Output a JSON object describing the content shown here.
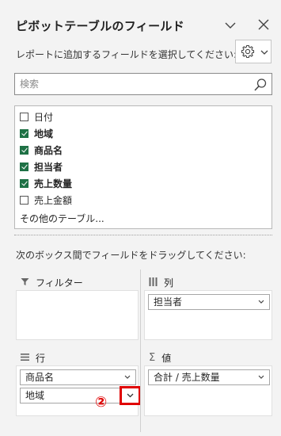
{
  "pane": {
    "title": "ピボットテーブルのフィールド"
  },
  "instruction": "レポートに追加するフィールドを選択してください:",
  "search": {
    "placeholder": "検索"
  },
  "fields": [
    {
      "label": "日付",
      "checked": false,
      "bold": false
    },
    {
      "label": "地域",
      "checked": true,
      "bold": true
    },
    {
      "label": "商品名",
      "checked": true,
      "bold": true
    },
    {
      "label": "担当者",
      "checked": true,
      "bold": true
    },
    {
      "label": "売上数量",
      "checked": true,
      "bold": true
    },
    {
      "label": "売上金額",
      "checked": false,
      "bold": false
    }
  ],
  "more_tables": "その他のテーブル...",
  "drag_instruction": "次のボックス間でフィールドをドラッグしてください:",
  "areas": {
    "filter": {
      "label": "フィルター"
    },
    "columns": {
      "label": "列",
      "items": [
        "担当者"
      ]
    },
    "rows": {
      "label": "行",
      "items": [
        "商品名",
        "地域"
      ]
    },
    "values": {
      "label": "値",
      "items": [
        "合計 / 売上数量"
      ]
    }
  },
  "annotation": {
    "marker": "②",
    "color": "#e00000"
  },
  "colors": {
    "check": "#1e7145",
    "background": "#f3f3f3"
  }
}
